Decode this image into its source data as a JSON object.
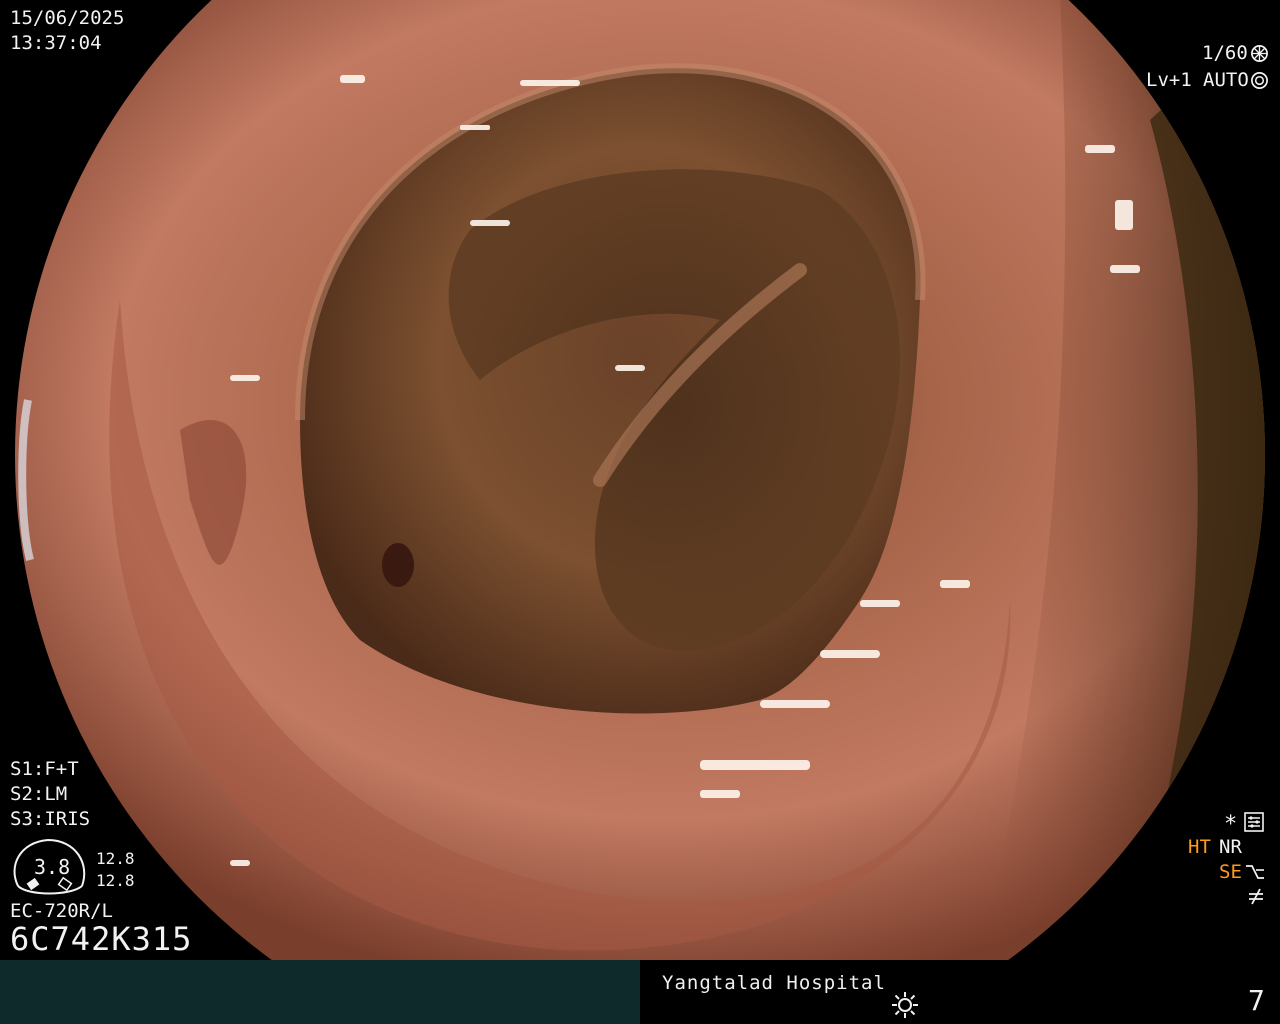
{
  "osd": {
    "date": "15/06/2025",
    "time": "13:37:04",
    "shutter": "1/60",
    "level": "Lv+1",
    "iris_mode": "AUTO",
    "s1": "S1:F+T",
    "s2": "S2:LM",
    "s3": "S3:IRIS",
    "gauge_value": "3.8",
    "gauge_top": "12.8",
    "gauge_bottom": "12.8",
    "scope_model": "EC-720R/L",
    "serial": "6C742K315",
    "star": "*",
    "ht": "HT",
    "nr": "NR",
    "se": "SE"
  },
  "footer": {
    "hospital": "Yangtalad Hospital",
    "page": "7"
  },
  "icons": {
    "shutter": "aperture-icon",
    "auto": "iris-icon",
    "settings": "settings-icon",
    "se": "structure-enhance-icon",
    "freeze": "not-equal-icon",
    "brightness": "sun-icon"
  },
  "colors": {
    "background": "#000000",
    "osd_text": "#f2f2f2",
    "highlight": "#ff9a1a",
    "footer_left": "#0f2a2a",
    "tissue": "#b8705a"
  }
}
